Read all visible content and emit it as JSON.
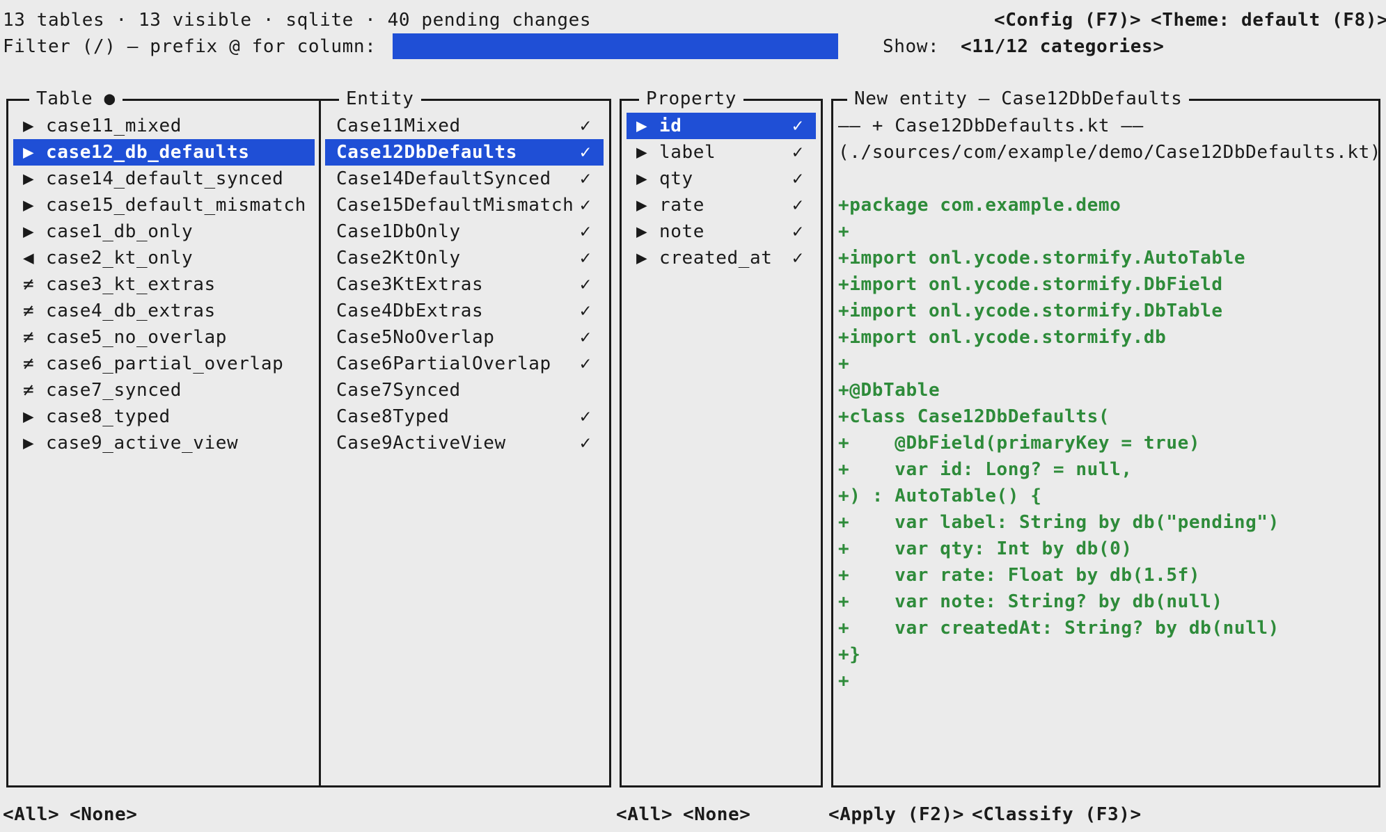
{
  "status": {
    "tables_summary": "13 tables · 13 visible · sqlite · 40 pending changes",
    "config_button": "<Config (F7)>",
    "theme_button": "<Theme: default (F8)>"
  },
  "filter": {
    "label": "Filter (/) — prefix @ for column:",
    "value": "",
    "show_label": "Show:",
    "categories_button": "<11/12 categories>"
  },
  "table_panel": {
    "title": "Table ●",
    "selected_index": 1,
    "items": [
      {
        "marker": "▶",
        "label": "case11_mixed"
      },
      {
        "marker": "▶",
        "label": "case12_db_defaults"
      },
      {
        "marker": "▶",
        "label": "case14_default_synced"
      },
      {
        "marker": "▶",
        "label": "case15_default_mismatch"
      },
      {
        "marker": "▶",
        "label": "case1_db_only"
      },
      {
        "marker": "◀",
        "label": "case2_kt_only"
      },
      {
        "marker": "≠",
        "label": "case3_kt_extras"
      },
      {
        "marker": "≠",
        "label": "case4_db_extras"
      },
      {
        "marker": "≠",
        "label": "case5_no_overlap"
      },
      {
        "marker": "≠",
        "label": "case6_partial_overlap"
      },
      {
        "marker": "≠",
        "label": "case7_synced"
      },
      {
        "marker": "▶",
        "label": "case8_typed"
      },
      {
        "marker": "▶",
        "label": "case9_active_view"
      }
    ]
  },
  "entity_panel": {
    "title": "Entity",
    "items": [
      {
        "label": "Case11Mixed",
        "check": "✓"
      },
      {
        "label": "Case12DbDefaults",
        "check": "✓"
      },
      {
        "label": "Case14DefaultSynced",
        "check": "✓"
      },
      {
        "label": "Case15DefaultMismatch",
        "check": "✓"
      },
      {
        "label": "Case1DbOnly",
        "check": "✓"
      },
      {
        "label": "Case2KtOnly",
        "check": "✓"
      },
      {
        "label": "Case3KtExtras",
        "check": "✓"
      },
      {
        "label": "Case4DbExtras",
        "check": "✓"
      },
      {
        "label": "Case5NoOverlap",
        "check": "✓"
      },
      {
        "label": "Case6PartialOverlap",
        "check": "✓"
      },
      {
        "label": "Case7Synced",
        "check": ""
      },
      {
        "label": "Case8Typed",
        "check": "✓"
      },
      {
        "label": "Case9ActiveView",
        "check": "✓"
      }
    ]
  },
  "property_panel": {
    "title": "Property",
    "selected_index": 0,
    "items": [
      {
        "marker": "▶",
        "label": "id",
        "check": "✓"
      },
      {
        "marker": "▶",
        "label": "label",
        "check": "✓"
      },
      {
        "marker": "▶",
        "label": "qty",
        "check": "✓"
      },
      {
        "marker": "▶",
        "label": "rate",
        "check": "✓"
      },
      {
        "marker": "▶",
        "label": "note",
        "check": "✓"
      },
      {
        "marker": "▶",
        "label": "created_at",
        "check": "✓"
      }
    ]
  },
  "preview_panel": {
    "title": "New entity — Case12DbDefaults",
    "file_header": "—— + Case12DbDefaults.kt ——",
    "file_path": "(./sources/com/example/demo/Case12DbDefaults.kt)",
    "code_lines": [
      "+package com.example.demo",
      "+",
      "+import onl.ycode.stormify.AutoTable",
      "+import onl.ycode.stormify.DbField",
      "+import onl.ycode.stormify.DbTable",
      "+import onl.ycode.stormify.db",
      "+",
      "+@DbTable",
      "+class Case12DbDefaults(",
      "+    @DbField(primaryKey = true)",
      "+    var id: Long? = null,",
      "+) : AutoTable() {",
      "+    var label: String by db(\"pending\")",
      "+    var qty: Int by db(0)",
      "+    var rate: Float by db(1.5f)",
      "+    var note: String? by db(null)",
      "+    var createdAt: String? by db(null)",
      "+}",
      "+"
    ]
  },
  "footer": {
    "all_left": "<All>",
    "none_left": "<None>",
    "all_right": "<All>",
    "none_right": "<None>",
    "apply_button": "<Apply (F2)>",
    "classify_button": "<Classify (F3)>"
  },
  "colors": {
    "background": "#ebebeb",
    "selection": "#1f4fd6",
    "code_added": "#2e8b3a"
  }
}
